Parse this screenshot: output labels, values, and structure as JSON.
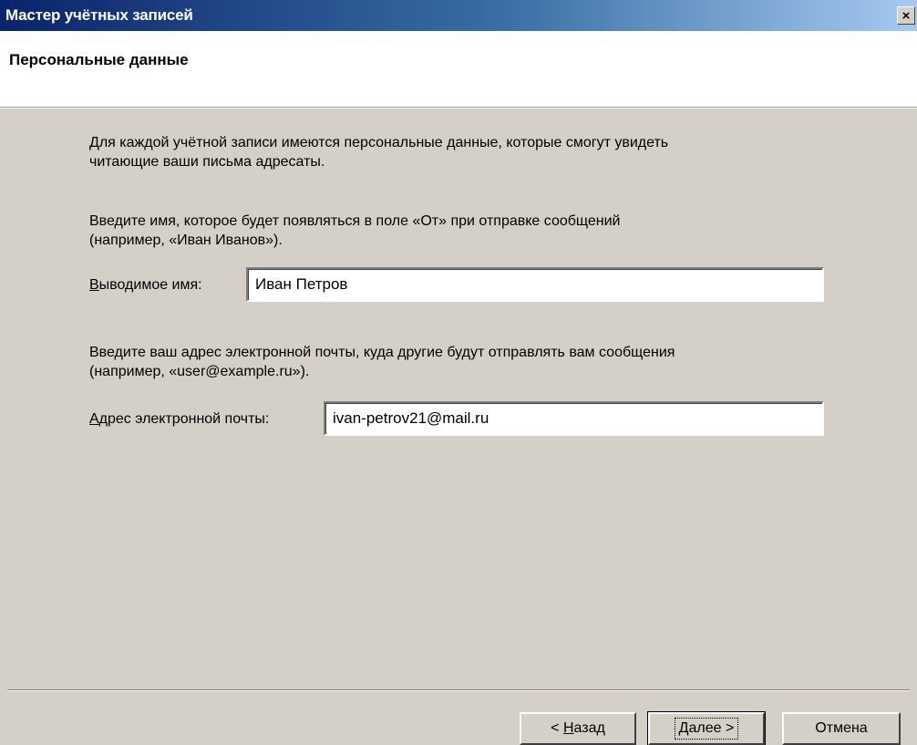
{
  "window": {
    "title": "Мастер учётных записей",
    "close_symbol": "×"
  },
  "header": {
    "title": "Персональные данные"
  },
  "content": {
    "intro_line1": "Для каждой учётной записи имеются персональные данные, которые смогут увидеть",
    "intro_line2": "читающие ваши письма адресаты.",
    "name_hint_line1": "Введите имя, которое будет появляться в поле «От» при отправке сообщений",
    "name_hint_line2": "(например, «Иван Иванов»).",
    "name_label_accel": "В",
    "name_label_rest": "ыводимое имя:",
    "name_value": "Иван Петров",
    "email_hint_line1": "Введите ваш адрес электронной почты, куда другие будут отправлять вам сообщения",
    "email_hint_line2": "(например, «user@example.ru»).",
    "email_label_accel": "А",
    "email_label_rest": "дрес электронной почты:",
    "email_value": "ivan-petrov21@mail.ru"
  },
  "buttons": {
    "back_prefix": "< ",
    "back_accel": "Н",
    "back_rest": "азад",
    "next_accel": "Д",
    "next_rest": "алее >",
    "cancel": "Отмена"
  },
  "colors": {
    "titlebar_start": "#0a246a",
    "titlebar_end": "#a6caf0",
    "dialog_face": "#d4d0c8"
  }
}
